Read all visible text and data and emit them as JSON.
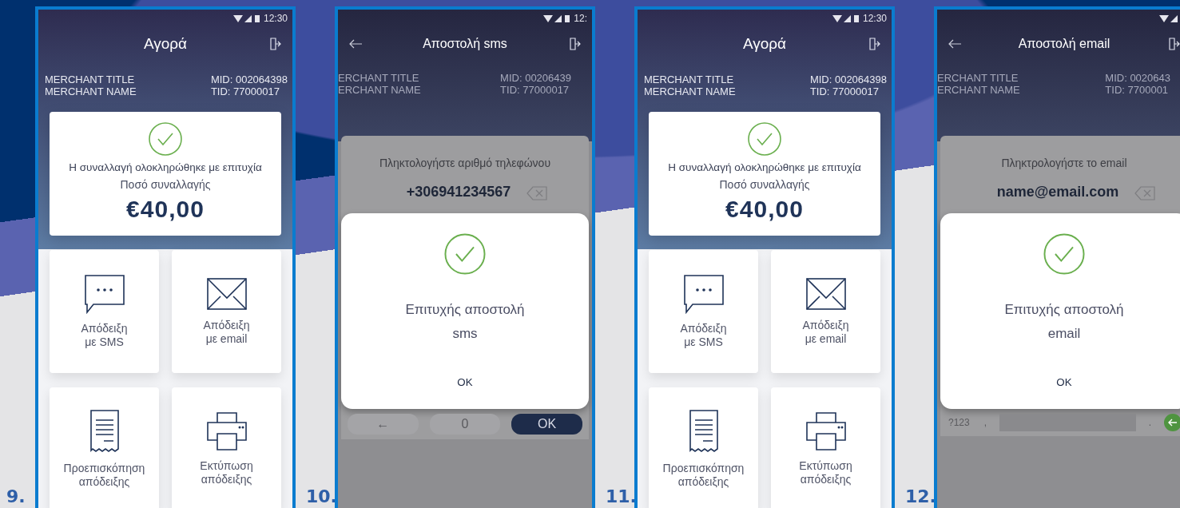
{
  "screens": [
    {
      "number": "9.",
      "kind": "receipt",
      "status_time": "12:30",
      "title": "Αγορά",
      "merchant_title": "MERCHANT TITLE",
      "merchant_name": "MERCHANT NAME",
      "mid": "MID: 002064398",
      "tid": "TID: 77000017",
      "result": "Η συναλλαγή ολοκληρώθηκε με επιτυχία",
      "amount_label": "Ποσό συναλλαγής",
      "amount": "€40,00",
      "tiles": [
        {
          "kind": "sms",
          "label": "Απόδειξη με SMS"
        },
        {
          "kind": "email",
          "label": "Απόδειξη με email"
        },
        {
          "kind": "preview",
          "label": "Προεπισκόπηση απόδειξης"
        },
        {
          "kind": "print",
          "label": "Εκτύπωση απόδειξης"
        }
      ]
    },
    {
      "number": "10.",
      "kind": "sent",
      "status_time": "12:",
      "title": "Αποστολή sms",
      "merchant_title": "ERCHANT TITLE",
      "merchant_name": "ERCHANT NAME",
      "mid": "MID: 00206439",
      "tid": "TID: 77000017",
      "prompt": "Πληκτολογήστε αριθμό τηλεφώνου",
      "value": "+306941234567",
      "message": "Επιτυχής αποστολή sms",
      "ok": "OK",
      "keys": [
        {
          "kind": "pad",
          "label": "←"
        },
        {
          "kind": "pad",
          "label": "0"
        },
        {
          "kind": "ok",
          "label": "OK"
        }
      ]
    },
    {
      "number": "11.",
      "kind": "receipt",
      "status_time": "12:30",
      "title": "Αγορά",
      "merchant_title": "MERCHANT TITLE",
      "merchant_name": "MERCHANT NAME",
      "mid": "MID: 002064398",
      "tid": "TID: 77000017",
      "result": "Η συναλλαγή ολοκληρώθηκε με επιτυχία",
      "amount_label": "Ποσό συναλλαγής",
      "amount": "€40,00",
      "tiles": [
        {
          "kind": "sms",
          "label": "Απόδειξη με SMS"
        },
        {
          "kind": "email",
          "label": "Απόδειξη με email"
        },
        {
          "kind": "preview",
          "label": "Προεπισκόπηση απόδειξης"
        },
        {
          "kind": "print",
          "label": "Εκτύπωση απόδειξης"
        }
      ]
    },
    {
      "number": "12.",
      "kind": "sent",
      "title": "Αποστολή email",
      "merchant_title": "ERCHANT TITLE",
      "merchant_name": "ERCHANT NAME",
      "mid": "MID: 0020643",
      "tid": "TID: 7700001",
      "prompt": "Πληκτρολογήστε το email",
      "value": "name@email.com",
      "message": "Επιτυχής αποστολή email",
      "ok": "OK",
      "keys": [
        {
          "kind": "char",
          "label": "?123"
        },
        {
          "kind": "char",
          "label": ","
        },
        {
          "kind": "space"
        },
        {
          "kind": "char",
          "label": "."
        },
        {
          "kind": "enter"
        }
      ]
    }
  ]
}
